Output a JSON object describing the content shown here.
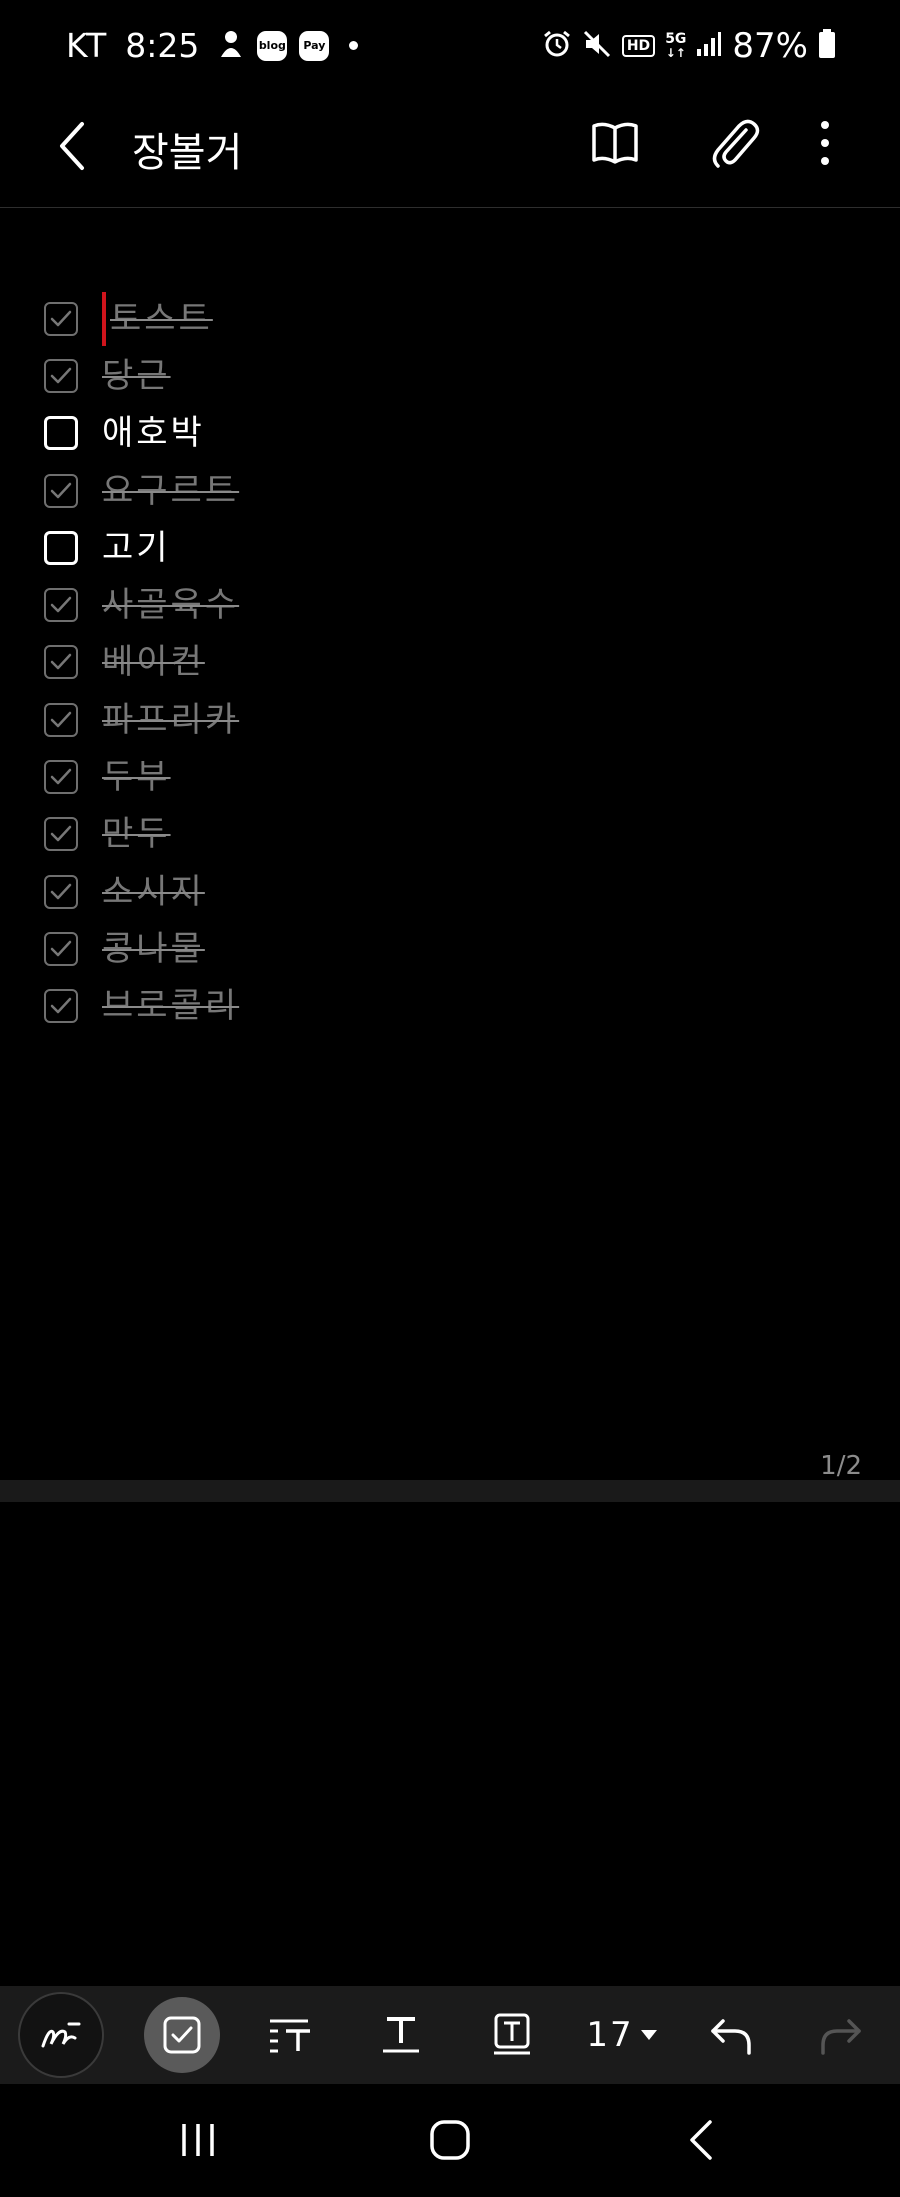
{
  "status_bar": {
    "carrier": "KT",
    "time": "8:25",
    "notif_blog": "blog",
    "notif_pay": "Pay",
    "network": "5G",
    "hd": "HD",
    "battery": "87%"
  },
  "app_bar": {
    "title": "장볼거"
  },
  "checklist": [
    {
      "text": "토스트",
      "checked": true
    },
    {
      "text": "당근",
      "checked": true
    },
    {
      "text": "애호박",
      "checked": false
    },
    {
      "text": "요구르트",
      "checked": true
    },
    {
      "text": "고기",
      "checked": false
    },
    {
      "text": "사골육수",
      "checked": true
    },
    {
      "text": "베이컨",
      "checked": true
    },
    {
      "text": "파프리카",
      "checked": true
    },
    {
      "text": "두부",
      "checked": true
    },
    {
      "text": "만두",
      "checked": true
    },
    {
      "text": "소시지",
      "checked": true
    },
    {
      "text": "콩나물",
      "checked": true
    },
    {
      "text": "브로콜리",
      "checked": true
    }
  ],
  "page_indicator": "1/2",
  "toolbar": {
    "font_size": "17"
  },
  "colors": {
    "background": "#000000",
    "checked_text": "#777777",
    "cursor": "#d0141c",
    "toolbar_bg": "#1b1b1b"
  }
}
